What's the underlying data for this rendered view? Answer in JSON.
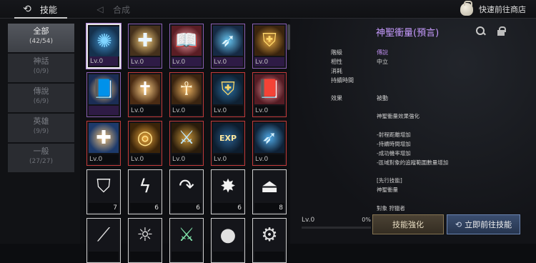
{
  "topbar": {
    "tabs": [
      {
        "label": "技能",
        "active": true,
        "icon": "skill-swirl-icon"
      },
      {
        "label": "合成",
        "active": false,
        "icon": "craft-icon"
      }
    ],
    "shop_link": "快速前往商店",
    "shop_icon": "money-bag-icon"
  },
  "sidebar": {
    "categories": [
      {
        "label": "全部",
        "count": "(42/54)",
        "active": true
      },
      {
        "label": "神話",
        "count": "(0/9)"
      },
      {
        "label": "傳說",
        "count": "(6/9)"
      },
      {
        "label": "英雄",
        "count": "(9/9)"
      },
      {
        "label": "一般",
        "count": "(27/27)"
      }
    ]
  },
  "grid": {
    "slots": [
      {
        "icon": "holy-star-icon",
        "grade": "purple",
        "level": "Lv.0",
        "selected": true
      },
      {
        "icon": "cross-shield-icon",
        "grade": "purple",
        "level": "Lv.0"
      },
      {
        "icon": "holy-book-icon",
        "grade": "purple",
        "level": "Lv.0"
      },
      {
        "icon": "charge-blade-icon",
        "grade": "purple",
        "level": "Lv.0"
      },
      {
        "icon": "shield-x-icon",
        "grade": "purple",
        "level": "Lv.0"
      },
      {
        "icon": "holy-book-blue-icon",
        "grade": "purple",
        "level": ""
      },
      {
        "icon": "holy-cross-icon",
        "grade": "red",
        "level": "Lv.0"
      },
      {
        "icon": "praying-hands-icon",
        "grade": "red",
        "level": "Lv.0"
      },
      {
        "icon": "shield-x-blue-icon",
        "grade": "red",
        "level": "Lv.0"
      },
      {
        "icon": "holy-book-red-icon",
        "grade": "red",
        "level": "Lv.0"
      },
      {
        "icon": "cross-tome-icon",
        "grade": "red",
        "level": "Lv.0"
      },
      {
        "icon": "golden-orb-icon",
        "grade": "red",
        "level": "Lv.0"
      },
      {
        "icon": "golden-sword-icon",
        "grade": "red",
        "level": "Lv.0"
      },
      {
        "icon": "exp-gem-icon",
        "grade": "red",
        "level": "Lv.0"
      },
      {
        "icon": "wing-slash-icon",
        "grade": "red",
        "level": "Lv.0"
      },
      {
        "icon": "shield-outline-icon",
        "grade": "white",
        "level": "",
        "count": "7"
      },
      {
        "icon": "lightning-icon",
        "grade": "white",
        "level": "",
        "count": "6"
      },
      {
        "icon": "curve-arrow-icon",
        "grade": "white",
        "level": "",
        "count": "6"
      },
      {
        "icon": "starburst-icon",
        "grade": "white",
        "level": "",
        "count": "6"
      },
      {
        "icon": "weight-icon",
        "grade": "white",
        "level": "",
        "count": "8"
      },
      {
        "icon": "blade-icon",
        "grade": "white",
        "level": ""
      },
      {
        "icon": "sun-gear-icon",
        "grade": "white",
        "level": ""
      },
      {
        "icon": "green-sword-icon",
        "grade": "white",
        "level": ""
      },
      {
        "icon": "orb-icon",
        "grade": "white",
        "level": ""
      },
      {
        "icon": "gear-icon",
        "grade": "white",
        "level": ""
      }
    ]
  },
  "detail": {
    "title": "神聖衝量(預言)",
    "search_icon": "search-icon",
    "lock_icon": "lock-icon",
    "stats": [
      {
        "key": "階級",
        "value": "傳說",
        "accent": "#b98ae8"
      },
      {
        "key": "相性",
        "value": "中立"
      },
      {
        "key": "消耗",
        "value": ""
      },
      {
        "key": "持續時間",
        "value": ""
      }
    ],
    "effect_key": "效果",
    "effect_value": "被動",
    "body": [
      "神聖衝量效果強化",
      "-射程距離增加",
      "-持續時間增加",
      "-成功機率增加",
      "-區域對象的追蹤範圍數量增加",
      "[先行技能]",
      "神聖衝量",
      "對象 狩獵者"
    ],
    "footer_level": "Lv.0",
    "footer_pct": "0%",
    "progress": 0,
    "enhance_button": "技能強化",
    "goto_button": "立即前往技能",
    "goto_icon": "swirl-icon"
  }
}
